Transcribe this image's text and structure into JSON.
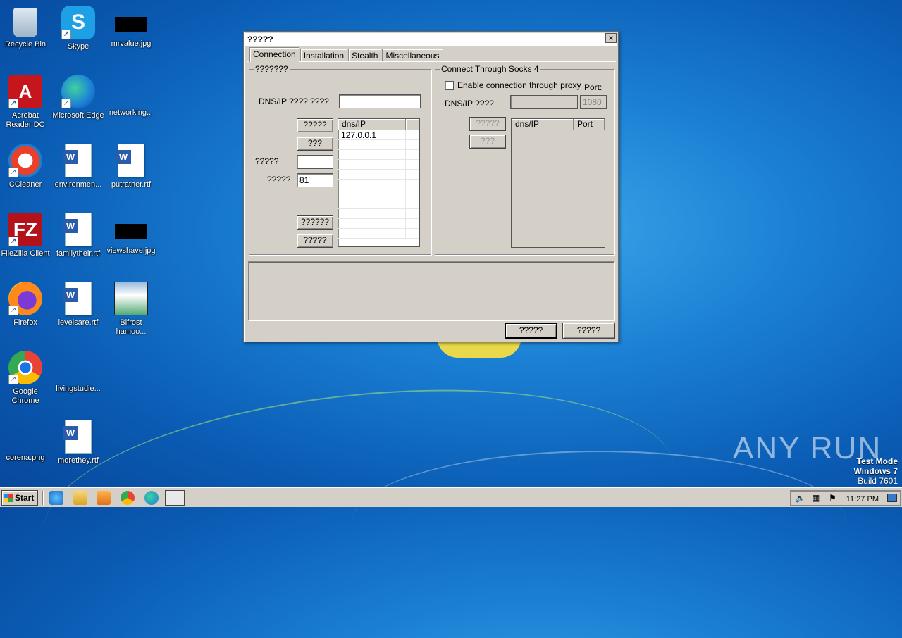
{
  "desktop": {
    "icons": [
      {
        "label": "Recycle Bin"
      },
      {
        "label": "Skype"
      },
      {
        "label": "mrvalue.jpg"
      },
      {
        "label": "Acrobat Reader DC"
      },
      {
        "label": "Microsoft Edge"
      },
      {
        "label": "networking..."
      },
      {
        "label": "CCleaner"
      },
      {
        "label": "environmen..."
      },
      {
        "label": "putrather.rtf"
      },
      {
        "label": "FileZilla Client"
      },
      {
        "label": "familytheir.rtf"
      },
      {
        "label": "viewshave.jpg"
      },
      {
        "label": "Firefox"
      },
      {
        "label": "levelsare.rtf"
      },
      {
        "label": "Bifrost hamoo..."
      },
      {
        "label": "Google Chrome"
      },
      {
        "label": "livingstudie..."
      },
      {
        "label": "corena.png"
      },
      {
        "label": "morethey.rtf"
      }
    ],
    "watermark": "ANY RUN",
    "testmode": {
      "line1": "Test Mode",
      "line2": "Windows 7",
      "line3": "Build 7601"
    }
  },
  "dialog": {
    "title": "?????",
    "close_glyph": "×",
    "tabs": [
      {
        "label": "Connection",
        "active": true
      },
      {
        "label": "Installation"
      },
      {
        "label": "Stealth"
      },
      {
        "label": "Miscellaneous"
      }
    ],
    "left_group": {
      "title": "???????",
      "dns_label": "DNS/IP  ???? ????",
      "dns_value": "",
      "add_button": "?????",
      "remove_button": "???",
      "field1_label": "?????",
      "field1_value": "",
      "port_label": "?????",
      "port_value": "81",
      "list_header": "dns/IP",
      "list_rows": [
        "127.0.0.1"
      ],
      "button_a": "??????",
      "button_b": "?????"
    },
    "right_group": {
      "title": "Connect Through Socks 4",
      "enable_label": "Enable connection through proxy",
      "port_label": "Port:",
      "dns_label": "DNS/IP ????",
      "dns_value": "",
      "port_value": "1080",
      "add_button": "?????",
      "remove_button": "???",
      "list_header_1": "dns/IP",
      "list_header_2": "Port"
    },
    "ok_button": "?????",
    "cancel_button": "?????"
  },
  "taskbar": {
    "start_label": "Start",
    "clock": "11:27 PM"
  }
}
